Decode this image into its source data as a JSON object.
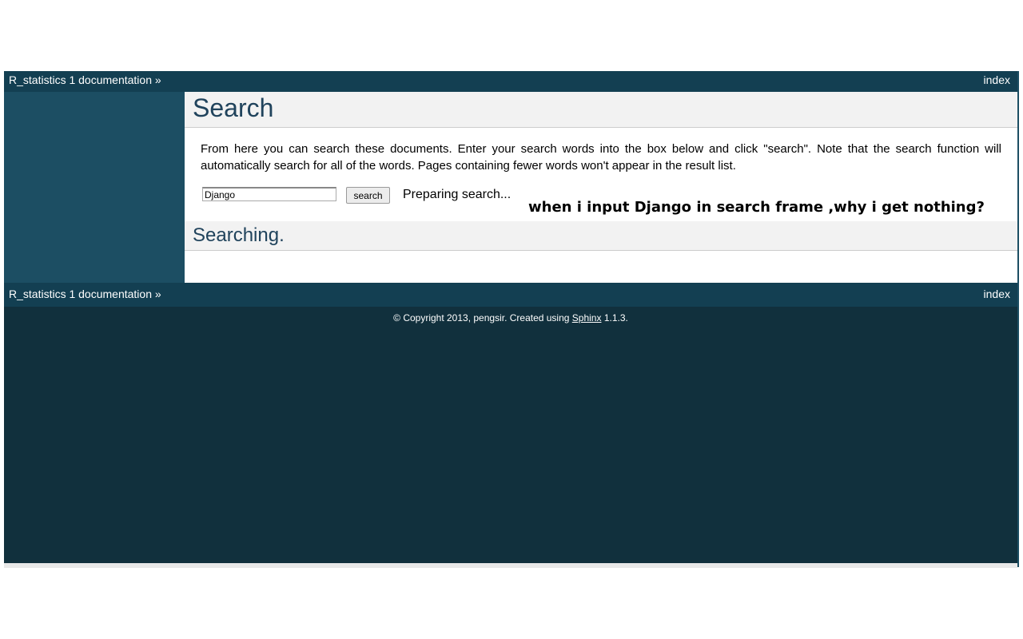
{
  "relbar": {
    "home_link": "R_statistics 1 documentation",
    "separator": "»",
    "index_link": "index"
  },
  "page": {
    "title": "Search",
    "intro": "From here you can search these documents. Enter your search words into the box below and click \"search\". Note that the search function will automatically search for all of the words. Pages containing fewer words won't appear in the result list.",
    "search_value": "Django",
    "search_button": "search",
    "status": "Preparing search...",
    "annotation": "when i input Django in search  frame ,why i get nothing?",
    "results_heading": "Searching."
  },
  "footer": {
    "copyright_prefix": "© Copyright 2013, pengsir. Created using ",
    "sphinx_link": "Sphinx",
    "copyright_suffix": " 1.1.3."
  },
  "colors": {
    "relbar": "#133f52",
    "sidebar": "#1c4e63",
    "footer_bg": "#11303d",
    "heading": "#20435c"
  }
}
